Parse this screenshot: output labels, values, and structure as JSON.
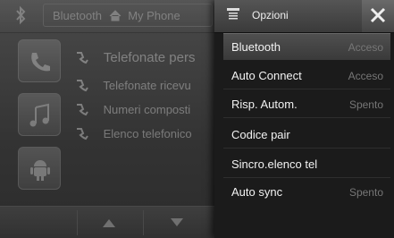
{
  "header": {
    "bluetooth_label": "Bluetooth",
    "phone_label": "My Phone"
  },
  "background_list": [
    {
      "label": "Telefonate pers"
    },
    {
      "label": "Telefonate ricevu"
    },
    {
      "label": "Numeri composti"
    },
    {
      "label": "Elenco telefonico"
    }
  ],
  "options_panel": {
    "title": "Opzioni",
    "items": [
      {
        "label": "Bluetooth",
        "value": "Acceso"
      },
      {
        "label": "Auto Connect",
        "value": "Acceso"
      },
      {
        "label": "Risp. Autom.",
        "value": "Spento"
      },
      {
        "label": "Codice pair",
        "value": ""
      },
      {
        "label": "Sincro.elenco tel",
        "value": ""
      },
      {
        "label": "Auto sync",
        "value": "Spento"
      }
    ]
  },
  "colors": {
    "panel_bg": "#1b1b1b",
    "value_text": "#767676",
    "label_text": "#f2f2f2"
  },
  "icons": [
    "bluetooth-icon",
    "home-icon",
    "phone-tile-icon",
    "music-tile-icon",
    "android-tile-icon",
    "menu-icon",
    "close-icon"
  ]
}
